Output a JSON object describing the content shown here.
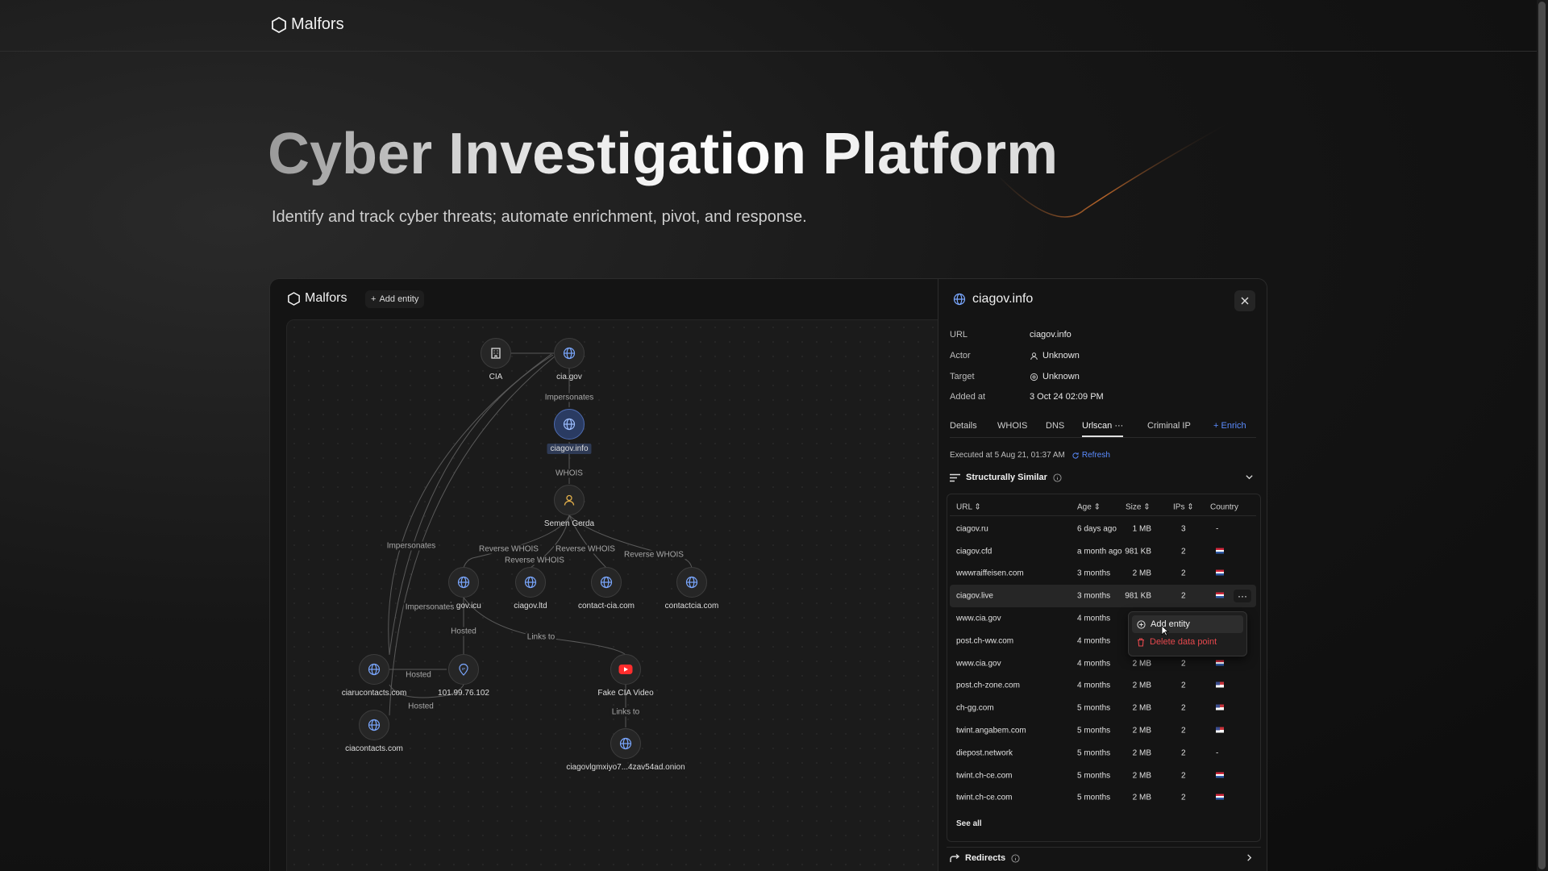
{
  "brand": {
    "name": "Malfors"
  },
  "hero": {
    "title": "Cyber Investigation Platform",
    "subtitle": "Identify and track cyber threats; automate enrichment, pivot, and response."
  },
  "app": {
    "brand": "Malfors",
    "add_entity_label": "Add entity"
  },
  "graph": {
    "nodes": [
      {
        "id": "cia",
        "label": "CIA",
        "icon": "building-icon"
      },
      {
        "id": "ciagov",
        "label": "cia.gov",
        "icon": "globe-icon"
      },
      {
        "id": "ciagovinfo",
        "label": "ciagov.info",
        "icon": "globe-icon",
        "selected": true
      },
      {
        "id": "semen",
        "label": "Semen Gerda",
        "icon": "person-icon"
      },
      {
        "id": "icu",
        "label": "ciagov.icu",
        "icon": "globe-icon"
      },
      {
        "id": "ltd",
        "label": "ciagov.ltd",
        "icon": "globe-icon"
      },
      {
        "id": "contactcia",
        "label": "contact-cia.com",
        "icon": "globe-icon"
      },
      {
        "id": "contactcia2",
        "label": "contactcia.com",
        "icon": "globe-icon"
      },
      {
        "id": "ciaru",
        "label": "ciarucontacts.com",
        "icon": "globe-icon"
      },
      {
        "id": "ip",
        "label": "101.99.76.102",
        "icon": "ip-pin-icon"
      },
      {
        "id": "video",
        "label": "Fake CIA Video",
        "icon": "youtube-icon"
      },
      {
        "id": "ciacontacts",
        "label": "ciacontacts.com",
        "icon": "globe-icon"
      },
      {
        "id": "onion",
        "label": "ciagovlgmxiyo7...4zav54ad.onion",
        "icon": "globe-icon"
      }
    ],
    "edges": {
      "impersonates": "Impersonates",
      "whois": "WHOIS",
      "reverse_whois": "Reverse WHOIS",
      "hosted": "Hosted",
      "links_to": "Links to"
    }
  },
  "panel": {
    "title": "ciagov.info",
    "fields": [
      {
        "key": "URL",
        "value": "ciagov.info"
      },
      {
        "key": "Actor",
        "value": "Unknown"
      },
      {
        "key": "Target",
        "value": "Unknown"
      },
      {
        "key": "Added at",
        "value": "3 Oct 24 02:09 PM"
      }
    ],
    "tabs": [
      "Details",
      "WHOIS",
      "DNS",
      "Urlscan",
      "Criminal IP"
    ],
    "active_tab": "Urlscan",
    "enrich_label": "Enrich",
    "executed": "Executed at 5 Aug 21, 01:37 AM",
    "refresh_label": "Refresh",
    "section_title": "Structurally Similar",
    "columns": [
      "URL",
      "Age",
      "Size",
      "IPs",
      "Country"
    ],
    "rows": [
      {
        "url": "ciagov.ru",
        "age": "6 days ago",
        "size": "1 MB",
        "ips": "3",
        "country": "-"
      },
      {
        "url": "ciagov.cfd",
        "age": "a month ago",
        "size": "981 KB",
        "ips": "2",
        "country": "nl"
      },
      {
        "url": "wwwraiffeisen.com",
        "age": "3 months",
        "size": "2 MB",
        "ips": "2",
        "country": "nl"
      },
      {
        "url": "ciagov.live",
        "age": "3 months",
        "size": "981 KB",
        "ips": "2",
        "country": "nl"
      },
      {
        "url": "www.cia.gov",
        "age": "4 months",
        "size": "",
        "ips": "",
        "country": ""
      },
      {
        "url": "post.ch-ww.com",
        "age": "4 months",
        "size": "",
        "ips": "",
        "country": ""
      },
      {
        "url": "www.cia.gov",
        "age": "4 months",
        "size": "2 MB",
        "ips": "2",
        "country": "nl"
      },
      {
        "url": "post.ch-zone.com",
        "age": "4 months",
        "size": "2 MB",
        "ips": "2",
        "country": "us"
      },
      {
        "url": "ch-gg.com",
        "age": "5 months",
        "size": "2 MB",
        "ips": "2",
        "country": "us"
      },
      {
        "url": "twint.angabem.com",
        "age": "5 months",
        "size": "2 MB",
        "ips": "2",
        "country": "us"
      },
      {
        "url": "diepost.network",
        "age": "5 months",
        "size": "2 MB",
        "ips": "2",
        "country": "-"
      },
      {
        "url": "twint.ch-ce.com",
        "age": "5 months",
        "size": "2 MB",
        "ips": "2",
        "country": "nl"
      },
      {
        "url": "twint.ch-ce.com",
        "age": "5 months",
        "size": "2 MB",
        "ips": "2",
        "country": "nl"
      }
    ],
    "see_all": "See all",
    "context_menu": {
      "add": "Add entity",
      "delete": "Delete data point"
    },
    "redirects_title": "Redirects"
  },
  "colors": {
    "accent": "#5b8cff",
    "danger": "#e5484d",
    "node_selected": "#2a3b62"
  }
}
